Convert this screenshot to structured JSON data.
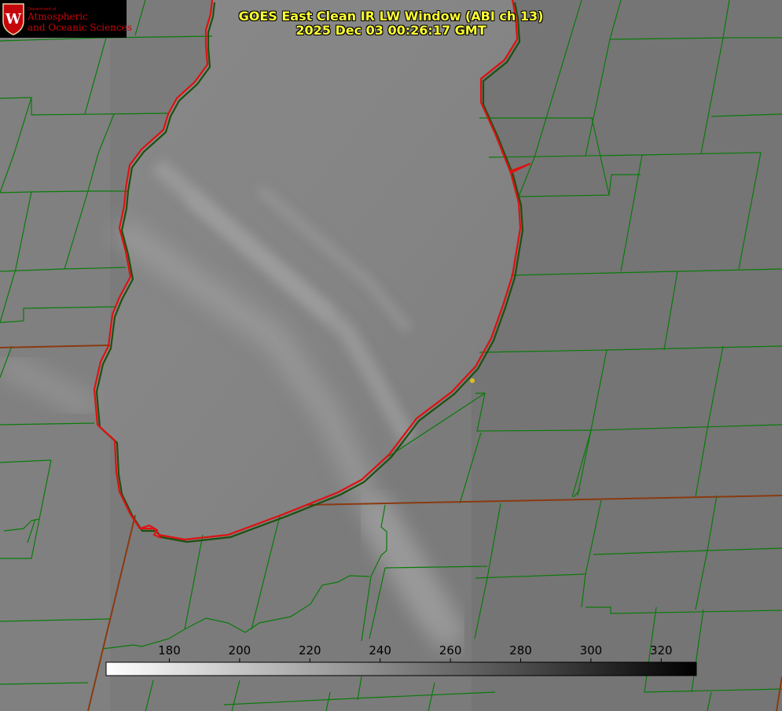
{
  "title": {
    "line1": "GOES East Clean IR LW Window (ABI ch 13)",
    "line2": "2025 Dec 03 00:26:17 GMT"
  },
  "logo": {
    "department_label": "Department of",
    "line1": "Atmospheric",
    "line2": "and Oceanic Sciences",
    "seal_letter": "W"
  },
  "colorbar": {
    "ticks": [
      180,
      200,
      220,
      240,
      260,
      280,
      300,
      320
    ],
    "min": 162,
    "max": 330,
    "scale": "white-to-black"
  },
  "colors": {
    "coastline": "#e01010",
    "county_lines": "#0a7a0a",
    "state_lines": "#8a3a10",
    "title_text": "#ffff33",
    "marker": "#d8c020"
  },
  "marker": {
    "type": "station-dot"
  }
}
